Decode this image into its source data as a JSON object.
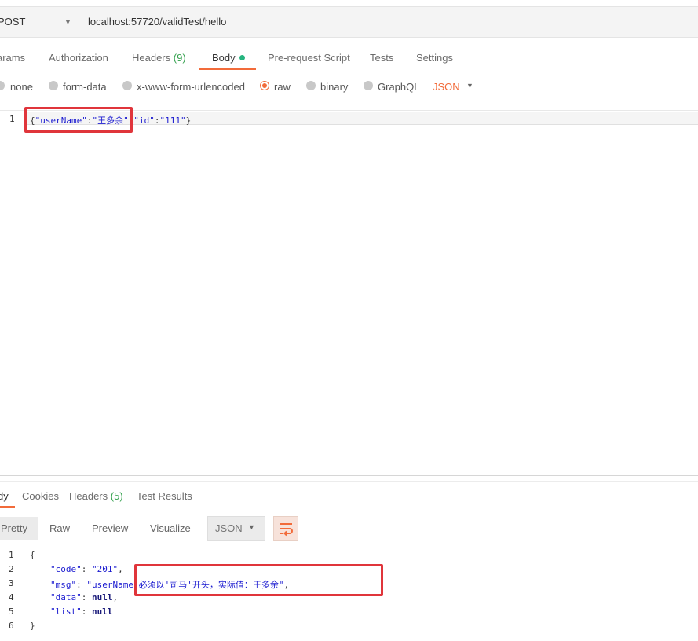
{
  "request": {
    "method": "POST",
    "url": "localhost:57720/validTest/hello"
  },
  "tabs": [
    {
      "label": "arams"
    },
    {
      "label": "Authorization"
    },
    {
      "label": "Headers",
      "count": "(9)"
    },
    {
      "label": "Body"
    },
    {
      "label": "Pre-request Script"
    },
    {
      "label": "Tests"
    },
    {
      "label": "Settings"
    }
  ],
  "body_types": [
    "none",
    "form-data",
    "x-www-form-urlencoded",
    "raw",
    "binary",
    "GraphQL"
  ],
  "selected_body_type": "raw",
  "body_format": "JSON",
  "request_body": {
    "line_no": "1",
    "open": "{",
    "key1": "\"userName\"",
    "colon": ":",
    "val1": "\"王多余\"",
    "comma": ",",
    "key2": "\"id\"",
    "val2": "\"111\"",
    "close": "}"
  },
  "response_tabs": [
    {
      "label": "dy"
    },
    {
      "label": "Cookies"
    },
    {
      "label": "Headers",
      "count": "(5)"
    },
    {
      "label": "Test Results"
    }
  ],
  "view_modes": [
    "Pretty",
    "Raw",
    "Preview",
    "Visualize"
  ],
  "response_format": "JSON",
  "response_body": {
    "line_numbers": [
      "1",
      "2",
      "3",
      "4",
      "5",
      "6"
    ],
    "l1": "{",
    "code_key": "\"code\"",
    "code_val": "\"201\"",
    "msg_key": "\"msg\"",
    "msg_val_start": "\"userName",
    "msg_val_rest": "必须以'司马'开头，实际值：王多余\"",
    "data_key": "\"data\"",
    "data_val": "null",
    "list_key": "\"list\"",
    "list_val": "null",
    "l6": "}"
  },
  "colors": {
    "accent": "#f26b3a",
    "highlight_box": "#e0353b",
    "count_green": "#33a14d"
  }
}
